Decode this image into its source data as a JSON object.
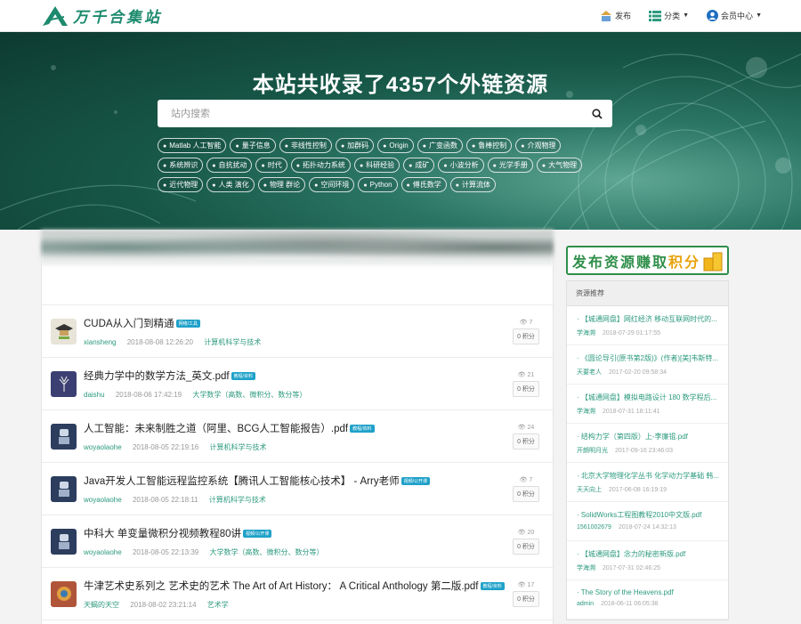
{
  "header": {
    "logo_text": "万千合集站",
    "nav": [
      {
        "label": "发布",
        "icon": "upload-icon"
      },
      {
        "label": "分类",
        "icon": "list-icon"
      },
      {
        "label": "会员中心",
        "icon": "user-icon"
      }
    ]
  },
  "hero": {
    "title": "本站共收录了4357个外链资源",
    "search_placeholder": "站内搜索",
    "tags": [
      "Matlab 人工智能",
      "量子信息",
      "非线性控制",
      "加群码",
      "Origin",
      "广变函数",
      "鲁棒控制",
      "介观物理",
      "系统辨识",
      "自抗扰动",
      "时代",
      "拓扑动力系统",
      "科研经验",
      "成矿",
      "小波分析",
      "光学手册",
      "大气物理",
      "近代物理",
      "人类 演化",
      "物理 群论",
      "空间环境",
      "Python",
      "傅氏数学",
      "计算流体"
    ]
  },
  "items": [
    {
      "title": "CUDA从入门到精通",
      "badge": "网络/工具",
      "user": "xiansheng",
      "date": "2018-08-08 12:26:20",
      "category": "计算机科学与技术",
      "views": "7",
      "points": "0 积分",
      "thumb_color": "#e8e4d8",
      "thumb_icon": "scholar-icon"
    },
    {
      "title": "经典力学中的数学方法_英文.pdf",
      "badge": "教程/资料",
      "user": "daishu",
      "date": "2018-08-06 17:42:19",
      "category": "大学数学（高数、微积分、数分等）",
      "views": "21",
      "points": "0 积分",
      "thumb_color": "#3b3f72",
      "thumb_icon": "tree-icon"
    },
    {
      "title": "人工智能：未来制胜之道（阿里、BCG人工智能报告）.pdf",
      "badge": "教程/资料",
      "user": "woyaolaohe",
      "date": "2018-08-05 22:19:16",
      "category": "计算机科学与技术",
      "views": "24",
      "points": "0 积分",
      "thumb_color": "#2c3d5e",
      "thumb_icon": "robot-icon"
    },
    {
      "title": "Java开发人工智能远程监控系统【腾讯人工智能核心技术】 - Arry老师",
      "badge": "视频/公开课",
      "user": "woyaolaohe",
      "date": "2018-08-05 22:18:11",
      "category": "计算机科学与技术",
      "views": "7",
      "points": "0 积分",
      "thumb_color": "#2c3d5e",
      "thumb_icon": "robot-icon"
    },
    {
      "title": "中科大 单变量微积分视频教程80讲",
      "badge": "视频/公开课",
      "user": "woyaolaohe",
      "date": "2018-08-05 22:13:39",
      "category": "大学数学（高数、微积分、数分等）",
      "views": "20",
      "points": "0 积分",
      "thumb_color": "#2c3d5e",
      "thumb_icon": "robot-icon"
    },
    {
      "title": "牛津艺术史系列之 艺术史的艺术 The Art of Art History： A Critical Anthology 第二版.pdf",
      "badge": "教程/资料",
      "user": "天蝎的天空",
      "date": "2018-08-02 23:21:14",
      "category": "艺术学",
      "views": "17",
      "points": "0 积分",
      "thumb_color": "#b0553a",
      "thumb_icon": "art-icon"
    }
  ],
  "sidebar": {
    "promo_text": "发布资源赚取",
    "promo_accent": "积分",
    "panel_title": "资源推荐",
    "recommendations": [
      {
        "title": "· 【城通网盘】网红经济 移动互联网时代的...",
        "user": "学海溯",
        "date": "2018-07-29 01:17:55"
      },
      {
        "title": "· 《圆论导引(原书第2版)》(作者)[美]韦斯特...",
        "user": "天要老人",
        "date": "2017-02-20 09:58:34"
      },
      {
        "title": "· 【城通网盘】模拟电路设计 180 数学程后...",
        "user": "学海溯",
        "date": "2018-07-31 18:11:41"
      },
      {
        "title": "· 结构力学（第四版）上-李廉锟.pdf",
        "user": "开朗明月光",
        "date": "2017-09-16 23:46:03"
      },
      {
        "title": "· 北京大学物理化学丛书 化学动力学基础 韩...",
        "user": "天天向上",
        "date": "2017-06-08 16:19:19"
      },
      {
        "title": "· SolidWorks工程图教程2010中文版.pdf",
        "user": "1561002679",
        "date": "2018-07-24 14:32:13"
      },
      {
        "title": "· 【城通网盘】念力的秘密新版.pdf",
        "user": "学海溯",
        "date": "2017-07-31 02:46:25"
      },
      {
        "title": "· The Story of the Heavens.pdf",
        "user": "admin",
        "date": "2018-06-11 06:05:38"
      }
    ]
  },
  "colors": {
    "brand": "#1d8a6e",
    "hero_dark": "#0d3a31",
    "badge": "#1fa1c9",
    "promo_green": "#2f8f4a",
    "promo_gold": "#e9a20c"
  }
}
